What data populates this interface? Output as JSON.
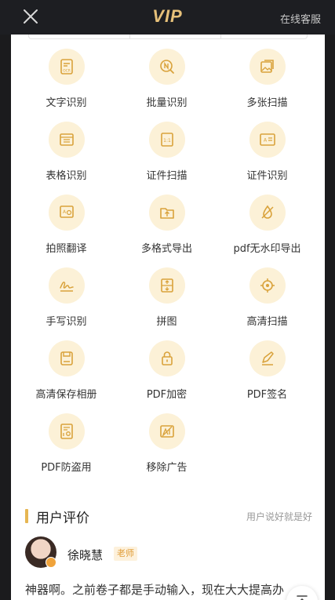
{
  "header": {
    "title": "VIP",
    "service_label": "在线客服"
  },
  "features": [
    {
      "label": "文字识别",
      "icon": "ocr-text-icon"
    },
    {
      "label": "批量识别",
      "icon": "batch-recognize-icon"
    },
    {
      "label": "多张扫描",
      "icon": "multi-scan-icon"
    },
    {
      "label": "表格识别",
      "icon": "table-recognize-icon"
    },
    {
      "label": "证件扫描",
      "icon": "id-scan-icon"
    },
    {
      "label": "证件识别",
      "icon": "id-recognize-icon"
    },
    {
      "label": "拍照翻译",
      "icon": "photo-translate-icon"
    },
    {
      "label": "多格式导出",
      "icon": "export-icon"
    },
    {
      "label": "pdf无水印导出",
      "icon": "no-watermark-icon"
    },
    {
      "label": "手写识别",
      "icon": "handwriting-icon"
    },
    {
      "label": "拼图",
      "icon": "collage-icon"
    },
    {
      "label": "高清扫描",
      "icon": "hd-scan-icon"
    },
    {
      "label": "高清保存相册",
      "icon": "save-album-icon"
    },
    {
      "label": "PDF加密",
      "icon": "lock-icon"
    },
    {
      "label": "PDF签名",
      "icon": "sign-icon"
    },
    {
      "label": "PDF防盗用",
      "icon": "anti-theft-icon"
    },
    {
      "label": "移除广告",
      "icon": "remove-ads-icon"
    }
  ],
  "reviews": {
    "title": "用户评价",
    "subtitle": "用户说好就是好",
    "items": [
      {
        "name": "徐晓慧",
        "role": "老师",
        "text": "神器啊。之前卷子都是手动输入，现在大大提高办"
      }
    ]
  },
  "colors": {
    "accent": "#e6b652",
    "icon_bg": "#fcf1d7",
    "icon_stroke": "#d9a23b",
    "topbar": "#1d1e22"
  }
}
